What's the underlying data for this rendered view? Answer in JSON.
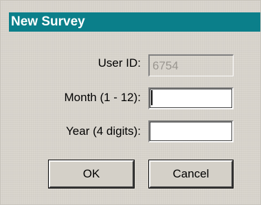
{
  "dialog": {
    "title": "New Survey"
  },
  "form": {
    "user_id_label": "User ID:",
    "user_id_value": "6754",
    "month_label": "Month (1 - 12):",
    "month_value": "",
    "year_label": "Year (4 digits):",
    "year_value": ""
  },
  "buttons": {
    "ok_label": "OK",
    "cancel_label": "Cancel"
  },
  "colors": {
    "titlebar": "#0b7f8a",
    "dialog_background": "#d4d0c8"
  }
}
